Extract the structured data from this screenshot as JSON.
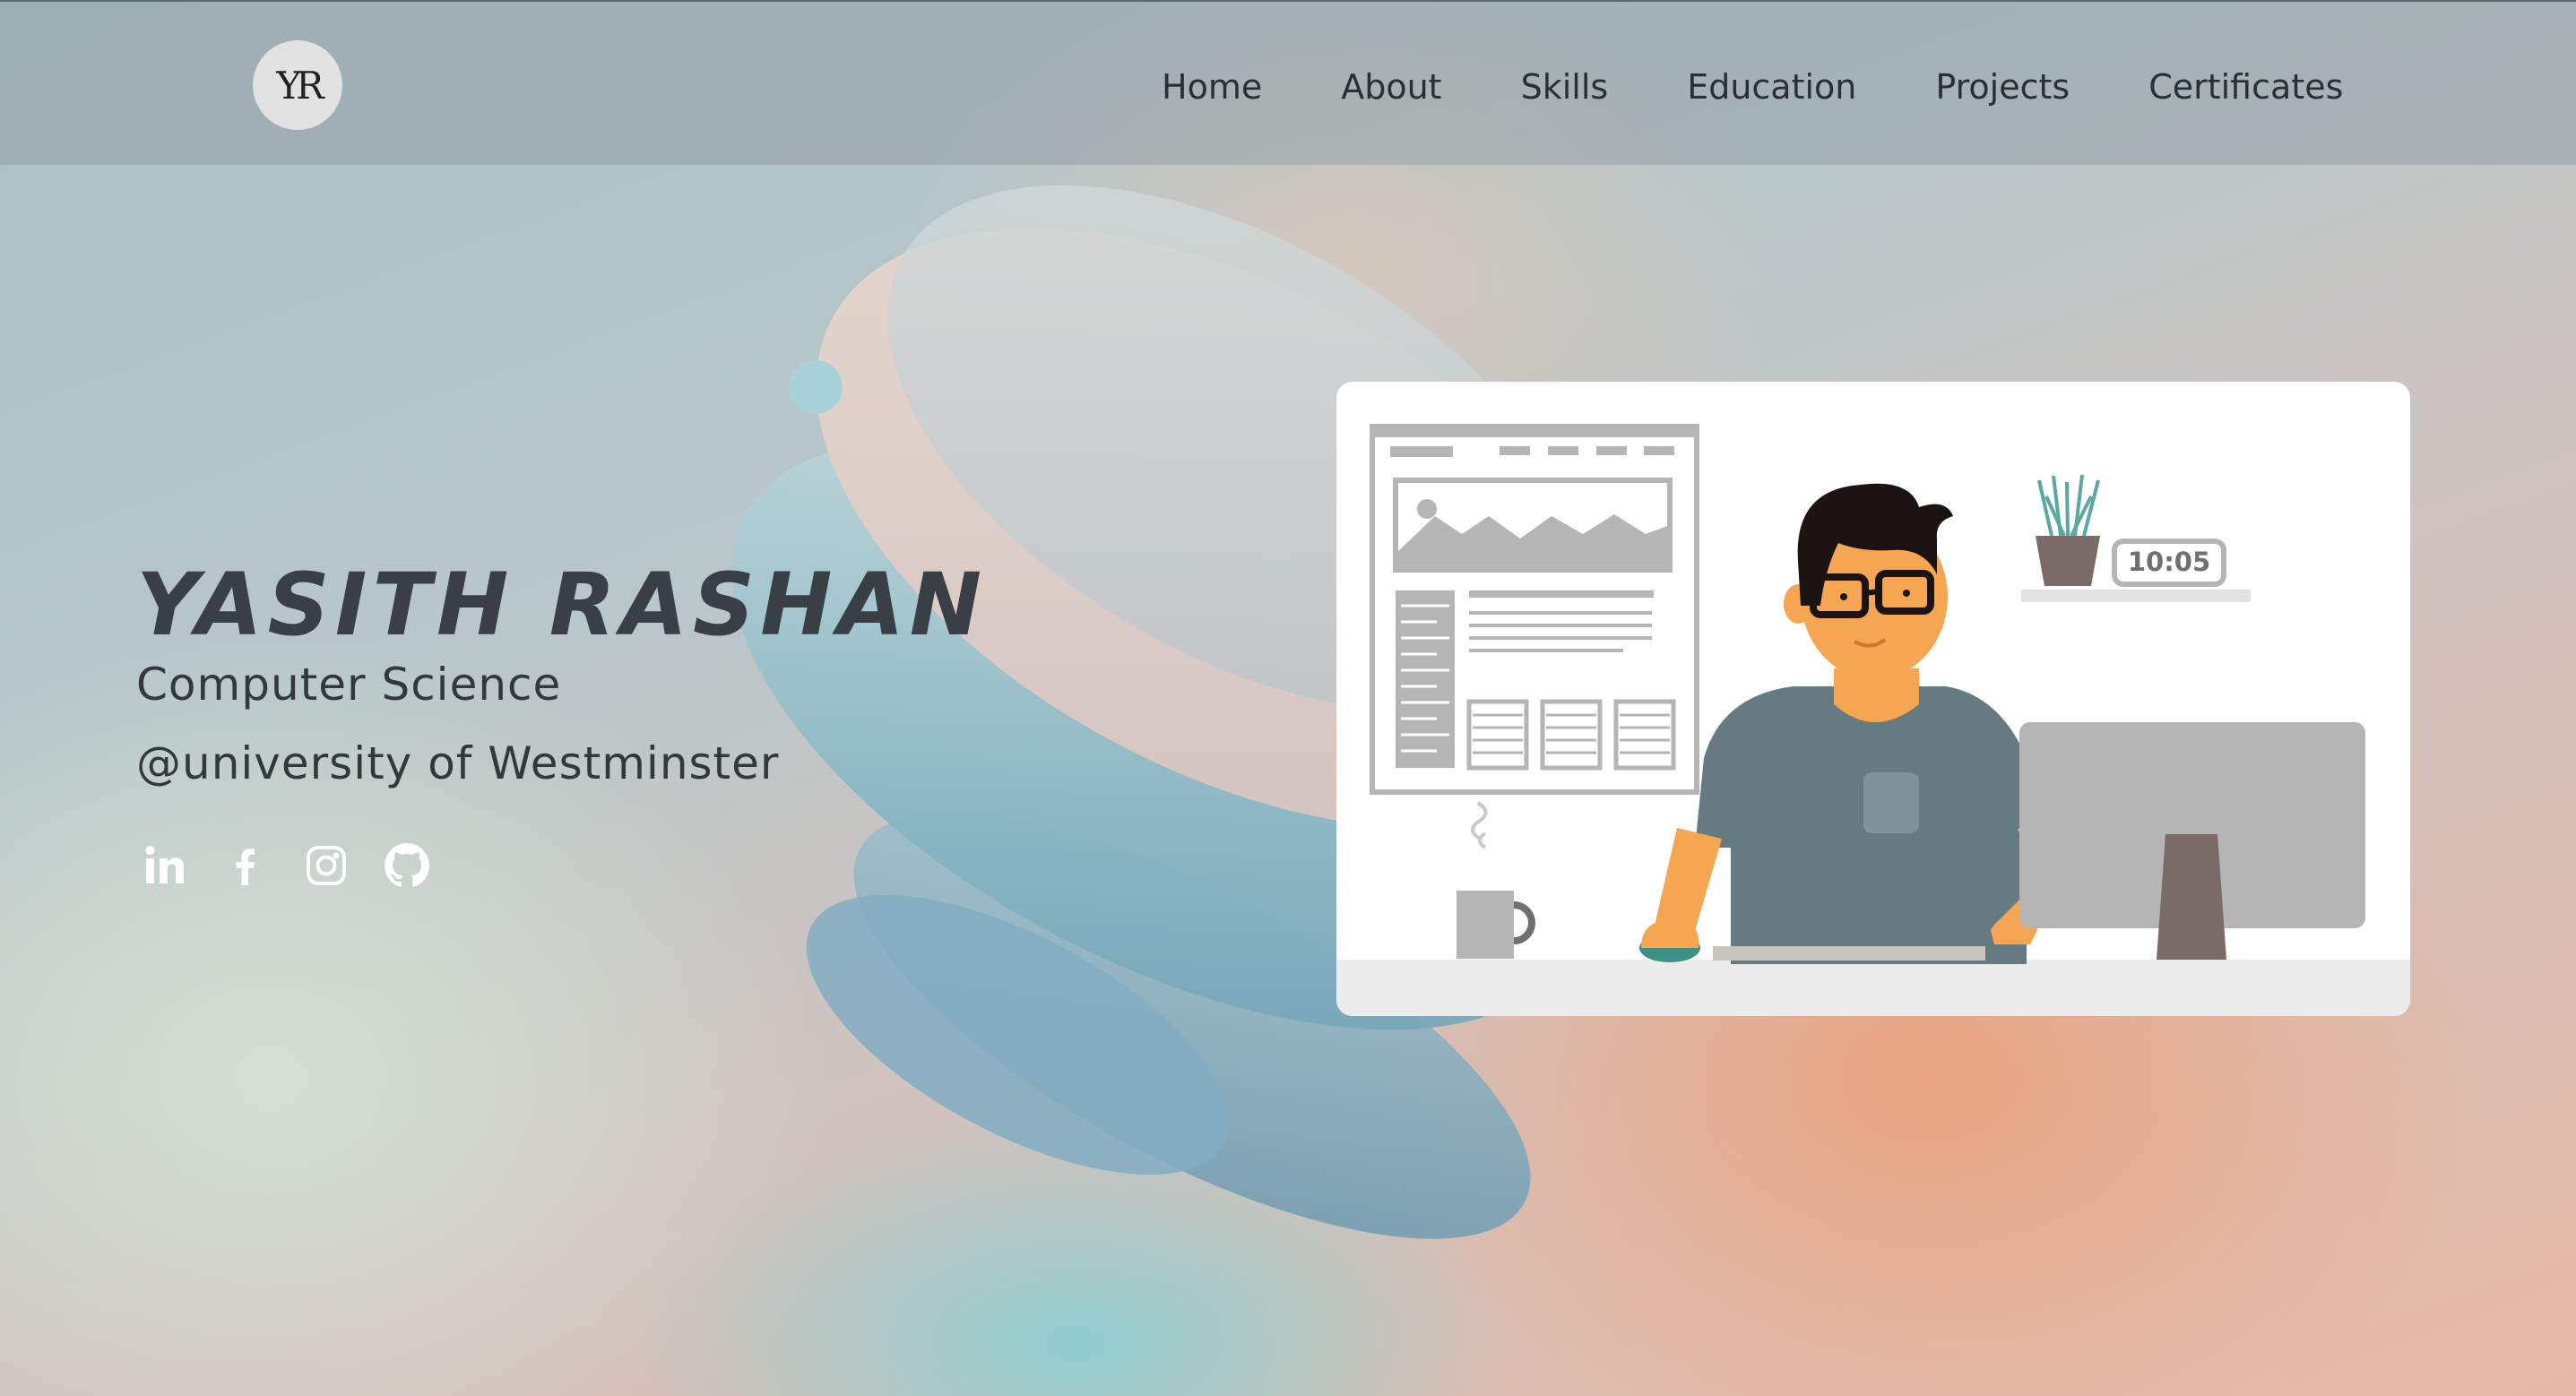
{
  "header": {
    "logo_text": "YR",
    "nav": [
      {
        "label": "Home"
      },
      {
        "label": "About"
      },
      {
        "label": "Skills"
      },
      {
        "label": "Education"
      },
      {
        "label": "Projects"
      },
      {
        "label": "Certificates"
      }
    ]
  },
  "hero": {
    "name": "YASITH RASHAN",
    "subtitle_line1": "Computer Science",
    "subtitle_line2": "@university of Westminster",
    "socials": [
      {
        "icon": "linkedin-icon"
      },
      {
        "icon": "facebook-icon"
      },
      {
        "icon": "instagram-icon"
      },
      {
        "icon": "github-icon"
      }
    ]
  },
  "illustration": {
    "clock_time": "10:05"
  },
  "colors": {
    "text_dark": "#2b2f33",
    "name_color": "#3a3f45",
    "accent_skin": "#f6a553",
    "shirt": "#667a82"
  }
}
